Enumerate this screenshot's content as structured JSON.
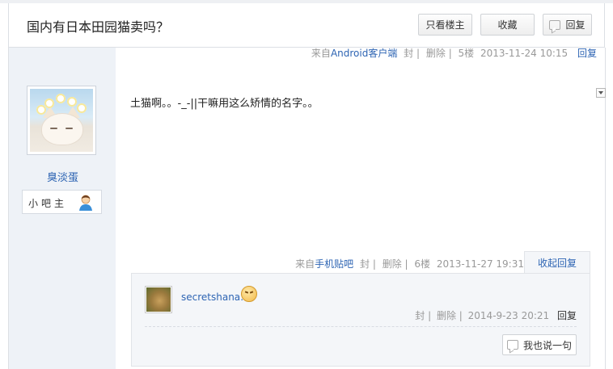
{
  "header": {
    "title": "国内有日本田园猫卖吗？",
    "buttons": {
      "only_lz": "只看楼主",
      "favorite": "收藏",
      "reply": "回复"
    }
  },
  "prev_floor": {
    "source_prefix": "来自",
    "source": "Android客户端",
    "block": "封",
    "delete": "删除",
    "floor": "5楼",
    "time": "2013-11-24 10:15",
    "reply": "回复"
  },
  "post": {
    "username": "臭淡蛋",
    "role": "小吧主",
    "icons": {
      "role": "user-icon",
      "avatar": "cat-with-flowers-avatar"
    },
    "content": "土猫啊。。-_-||干嘛用这么矫情的名字。。",
    "source_prefix": "来自",
    "source": "手机贴吧",
    "block": "封",
    "delete": "删除",
    "floor": "6楼",
    "time": "2013-11-27 19:31",
    "collapse_label": "收起回复"
  },
  "sub_reply": {
    "username": "secretshana:",
    "emoji": "angry-face-emoji",
    "block": "封",
    "delete": "删除",
    "time": "2014-9-23 20:21",
    "reply": "回复",
    "say_button": "我也说一句"
  },
  "colors": {
    "link": "#2d64b3",
    "sidebar_bg": "#eef2f7",
    "meta_text": "#999999"
  }
}
